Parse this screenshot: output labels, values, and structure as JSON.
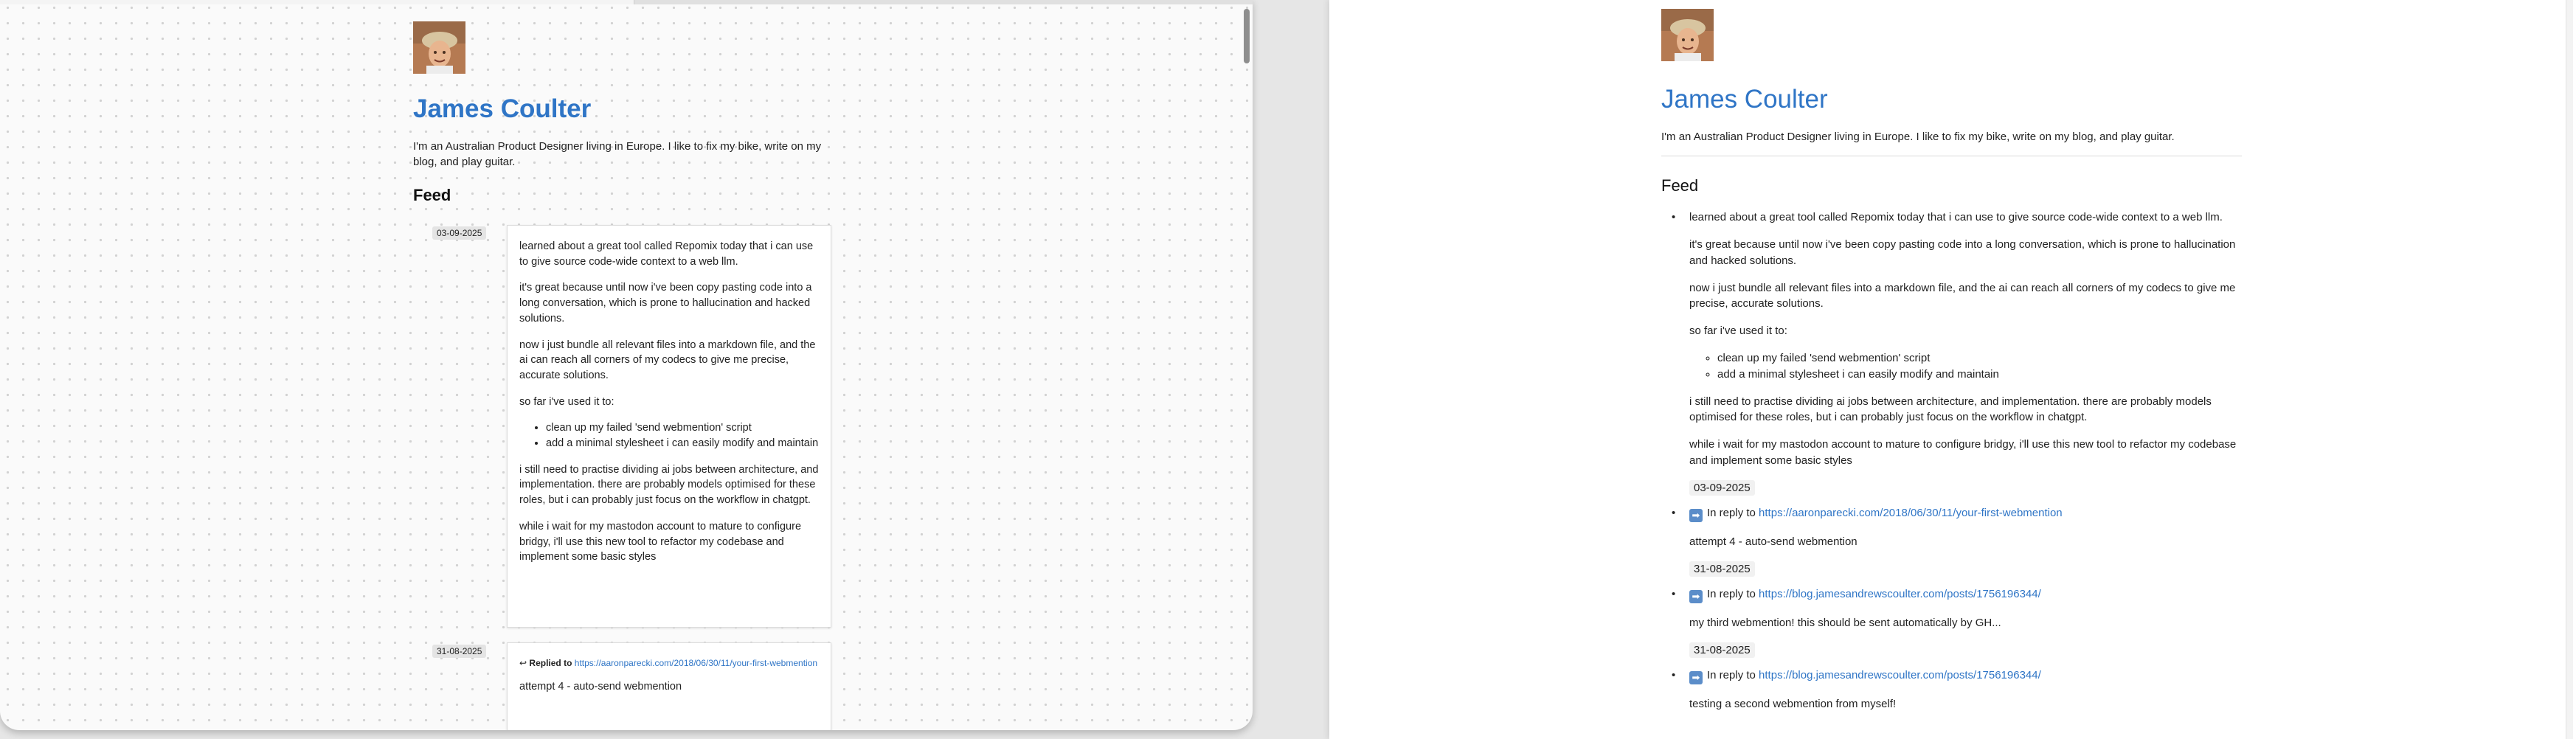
{
  "profile": {
    "name": "James Coulter",
    "bio": "I'm an Australian Product Designer living in Europe. I like to fix my bike, write on my blog, and play guitar."
  },
  "feed": {
    "heading": "Feed",
    "post1": {
      "date": "03-09-2025",
      "paragraphs": [
        "learned about a great tool called Repomix today that i can use to give source code-wide context to a web llm.",
        "it's great because until now i've been copy pasting code into a long conversation, which is prone to hallucination and hacked solutions.",
        "now i just bundle all relevant files into a markdown file, and the ai can reach all corners of my codecs to give me precise, accurate solutions.",
        "so far i've used it to:"
      ],
      "list": [
        "clean up my failed 'send webmention' script",
        "add a minimal stylesheet i can easily modify and maintain"
      ],
      "paragraphs_after": [
        "i still need to practise dividing ai jobs between architecture, and implementation. there are probably models optimised for these roles, but i can probably just focus on the workflow in chatgpt.",
        "while i wait for my mastodon account to mature to configure bridgy, i'll use this new tool to refactor my codebase and implement some basic styles"
      ]
    },
    "reply1": {
      "date": "03-09-2025",
      "left_date": "31-08-2025",
      "left_label": "Replied to",
      "right_label": "In reply to",
      "url": "https://aaronparecki.com/2018/06/30/11/your-first-webmention",
      "text": "attempt 4 - auto-send webmention"
    },
    "reply2": {
      "date": "31-08-2025",
      "right_label": "In reply to",
      "url": "https://blog.jamesandrewscoulter.com/posts/1756196344/",
      "text": "my third webmention! this should be sent automatically by GH..."
    },
    "reply3": {
      "date": "31-08-2025",
      "right_label": "In reply to",
      "url": "https://blog.jamesandrewscoulter.com/posts/1756196344/",
      "text": "testing a second webmention from myself!"
    }
  },
  "icons": {
    "reply_arrow_left": "↩",
    "reply_emoji_right": "➡",
    "avatar": "avatar-photo"
  },
  "colors": {
    "link": "#2f75c6",
    "name": "#2f75c6"
  }
}
